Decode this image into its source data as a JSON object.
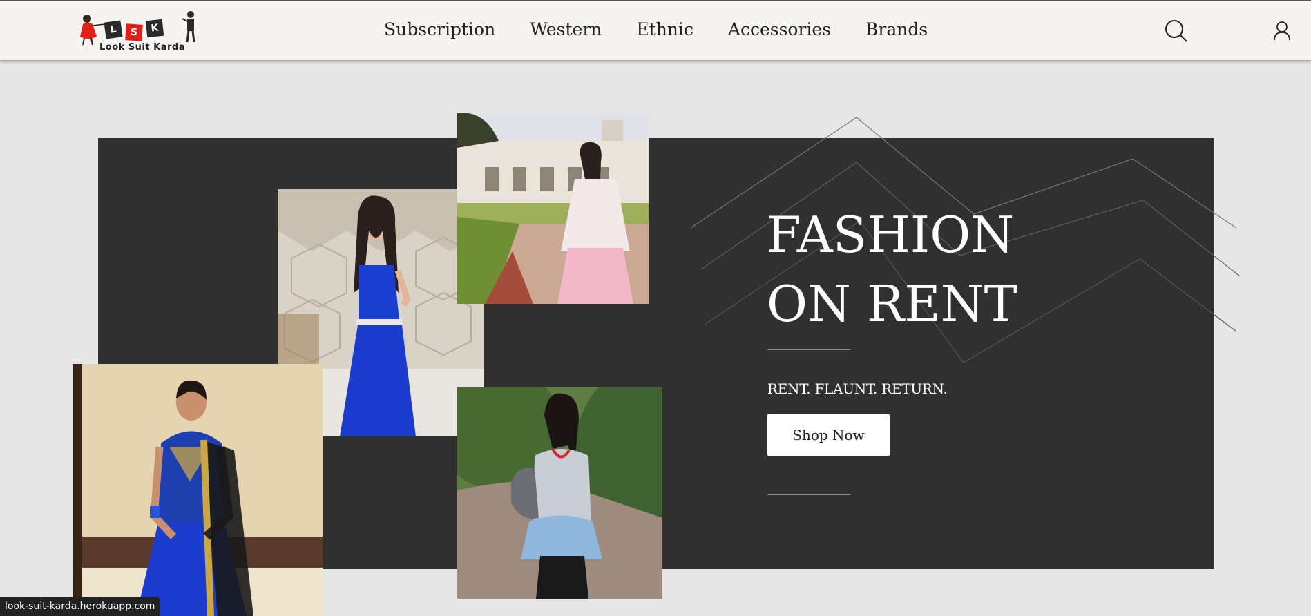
{
  "header": {
    "logo": {
      "letters": [
        "L",
        "S",
        "K"
      ],
      "name": "Look Suit Karda"
    },
    "nav": [
      "Subscription",
      "Western",
      "Ethnic",
      "Accessories",
      "Brands"
    ],
    "icons": {
      "search": "search-icon",
      "account": "user-icon"
    }
  },
  "hero": {
    "title_line1": "FASHION",
    "title_line2": "ON RENT",
    "tagline": "RENT. FLAUNT. RETURN.",
    "cta": "Shop Now"
  },
  "status_bar": {
    "url": "look-suit-karda.herokuapp.com"
  },
  "colors": {
    "header_bg": "#f5f4f2",
    "page_bg": "#e6e6e6",
    "hero_bg": "#303030",
    "logo_red": "#e0201b",
    "logo_dark": "#2a2a2a",
    "dress_blue": "#1a3fd0"
  }
}
